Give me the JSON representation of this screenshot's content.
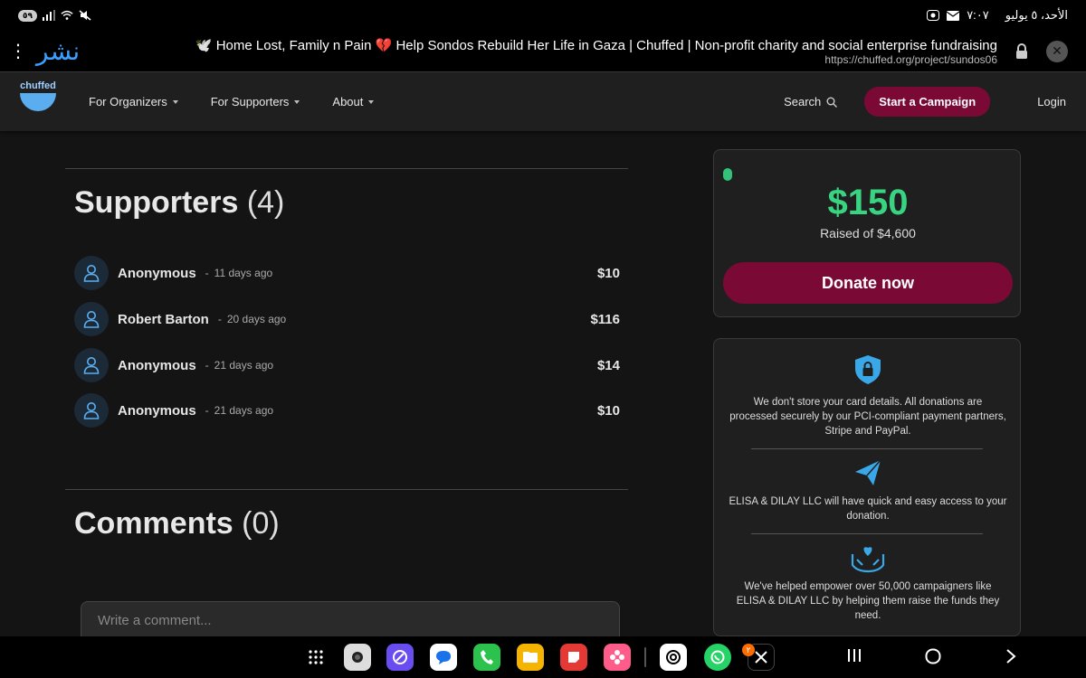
{
  "status_bar": {
    "battery": "٥٩",
    "date": "الأحد، ٥ يوليو",
    "time": "٧:٠٧"
  },
  "browser": {
    "brand": "نشر",
    "title": "🕊️ Home Lost, Family n Pain 💔 Help Sondos Rebuild Her Life in Gaza | Chuffed | Non-profit charity and social enterprise fundraising",
    "url": "https://chuffed.org/project/sundos06"
  },
  "nav": {
    "logo": "chuffed",
    "items": [
      {
        "label": "For Organizers"
      },
      {
        "label": "For Supporters"
      },
      {
        "label": "About"
      }
    ],
    "search_label": "Search",
    "start_campaign": "Start a Campaign",
    "login": "Login"
  },
  "supporters": {
    "title": "Supporters",
    "count": "(4)",
    "list": [
      {
        "name": "Anonymous",
        "sep": "-",
        "time": "11 days ago",
        "amount": "$10"
      },
      {
        "name": "Robert Barton",
        "sep": "-",
        "time": "20 days ago",
        "amount": "$116"
      },
      {
        "name": "Anonymous",
        "sep": "-",
        "time": "21 days ago",
        "amount": "$14"
      },
      {
        "name": "Anonymous",
        "sep": "-",
        "time": "21 days ago",
        "amount": "$10"
      }
    ]
  },
  "comments": {
    "title": "Comments",
    "count": "(0)",
    "placeholder": "Write a comment..."
  },
  "donation": {
    "raised": "$150",
    "raised_of": "Raised of $4,600",
    "donate_label": "Donate now"
  },
  "info": {
    "security": "We don't store your card details. All donations are processed securely by our PCI-compliant payment partners, Stripe and PayPal.",
    "access": "ELISA & DILAY LLC will have quick and easy access to your donation.",
    "empower": "We've helped empower over 50,000 campaigners like ELISA & DILAY LLC by helping them raise the funds they need."
  },
  "dock": {
    "badge": "٢"
  },
  "colors": {
    "accent": "#7a0a35",
    "raised_green": "#38d481",
    "icon_blue": "#3aa8e8"
  }
}
